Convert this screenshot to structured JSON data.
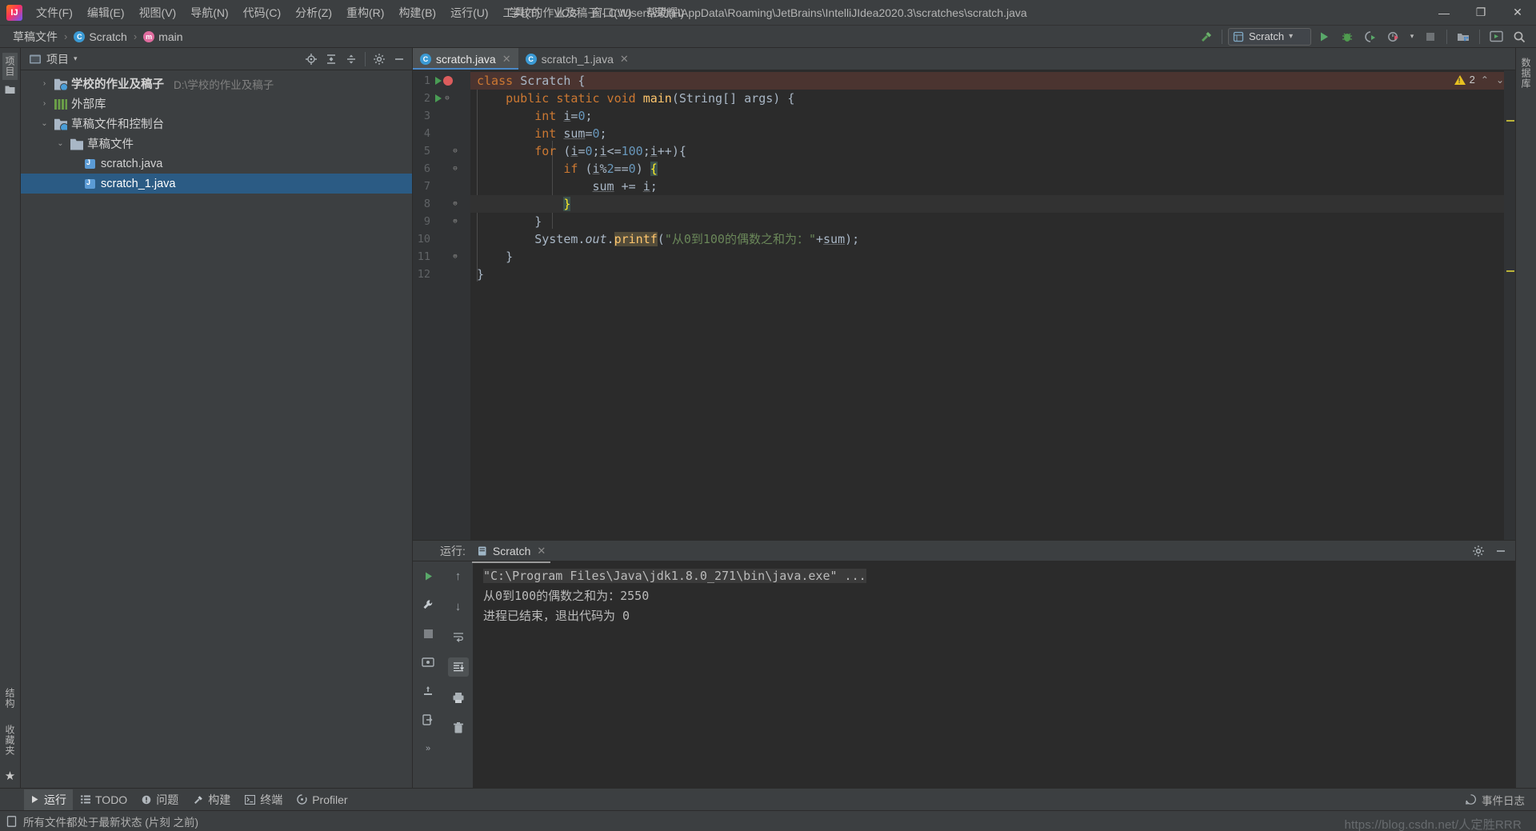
{
  "window": {
    "title": "学校的作业及稿子 - C:\\Users\\荣耀\\AppData\\Roaming\\JetBrains\\IntelliJIdea2020.3\\scratches\\scratch.java",
    "logo_text": "IJ",
    "minimize": "—",
    "maximize": "❐",
    "close": "✕"
  },
  "menu": {
    "items": [
      {
        "label": "文件(F)",
        "name": "menu-file"
      },
      {
        "label": "编辑(E)",
        "name": "menu-edit"
      },
      {
        "label": "视图(V)",
        "name": "menu-view"
      },
      {
        "label": "导航(N)",
        "name": "menu-navigate"
      },
      {
        "label": "代码(C)",
        "name": "menu-code"
      },
      {
        "label": "分析(Z)",
        "name": "menu-analyze"
      },
      {
        "label": "重构(R)",
        "name": "menu-refactor"
      },
      {
        "label": "构建(B)",
        "name": "menu-build"
      },
      {
        "label": "运行(U)",
        "name": "menu-run"
      },
      {
        "label": "工具(T)",
        "name": "menu-tools"
      },
      {
        "label": "VCS",
        "name": "menu-vcs"
      },
      {
        "label": "窗口(W)",
        "name": "menu-window"
      },
      {
        "label": "帮助(H)",
        "name": "menu-help"
      }
    ]
  },
  "navbar": {
    "breadcrumbs": [
      {
        "label": "草稿文件",
        "icon": "none"
      },
      {
        "label": "Scratch",
        "icon": "class-icon"
      },
      {
        "label": "main",
        "icon": "method-icon"
      }
    ],
    "separator": "›",
    "run_config": {
      "label": "Scratch",
      "icon": "scratch-config-icon",
      "chevron": "▾"
    },
    "buttons": [
      {
        "name": "build-hammer-icon",
        "title": "构建"
      },
      {
        "name": "run-button",
        "title": "运行"
      },
      {
        "name": "debug-button",
        "title": "调试"
      },
      {
        "name": "run-with-coverage-button",
        "title": "覆盖率运行"
      },
      {
        "name": "profiler-button",
        "title": "Profiler"
      },
      {
        "name": "stop-button",
        "title": "停止"
      },
      {
        "name": "project-structure-button",
        "title": "项目结构"
      },
      {
        "name": "updates-button",
        "title": "更新"
      },
      {
        "name": "search-everywhere-icon",
        "title": "搜索"
      }
    ]
  },
  "left_rail": {
    "top": [
      {
        "label": "项目",
        "name": "rail-project",
        "active": true
      },
      {
        "label": "",
        "name": "rail-bookmarks-icon",
        "active": false
      }
    ],
    "bottom": [
      {
        "label": "结构",
        "name": "rail-structure"
      },
      {
        "label": "收藏夹",
        "name": "rail-favorites"
      }
    ]
  },
  "right_rail": {
    "items": [
      {
        "label": "数据库",
        "name": "rail-database"
      }
    ]
  },
  "project_panel": {
    "title": "项目",
    "title_chevron": "▾",
    "header_buttons": [
      {
        "name": "locate-file-icon",
        "title": "定位"
      },
      {
        "name": "expand-all-icon",
        "title": "全部展开"
      },
      {
        "name": "collapse-all-icon",
        "title": "全部折叠"
      },
      {
        "name": "settings-gear-icon",
        "title": "设置"
      },
      {
        "name": "hide-panel-icon",
        "title": "隐藏"
      }
    ],
    "tree": [
      {
        "label": "学校的作业及稿子",
        "path": "D:\\学校的作业及稿子",
        "indent": 0,
        "arrow": "›",
        "icon": "module-folder-icon",
        "bold": true,
        "selected": false
      },
      {
        "label": "外部库",
        "path": "",
        "indent": 0,
        "arrow": "›",
        "icon": "library-icon",
        "bold": false,
        "selected": false
      },
      {
        "label": "草稿文件和控制台",
        "path": "",
        "indent": 0,
        "arrow": "⌄",
        "icon": "scratches-icon",
        "bold": false,
        "selected": false
      },
      {
        "label": "草稿文件",
        "path": "",
        "indent": 1,
        "arrow": "⌄",
        "icon": "folder-icon",
        "bold": false,
        "selected": false
      },
      {
        "label": "scratch.java",
        "path": "",
        "indent": 2,
        "arrow": "",
        "icon": "java-file-icon",
        "bold": false,
        "selected": false
      },
      {
        "label": "scratch_1.java",
        "path": "",
        "indent": 2,
        "arrow": "",
        "icon": "java-file-icon",
        "bold": false,
        "selected": true
      }
    ]
  },
  "editor": {
    "tabs": [
      {
        "label": "scratch.java",
        "active": true,
        "icon": "java-class-icon",
        "close": "✕"
      },
      {
        "label": "scratch_1.java",
        "active": false,
        "icon": "java-class-icon",
        "close": "✕"
      }
    ],
    "inspection": {
      "warning_count": "2",
      "up": "⌃",
      "down": "⌄"
    },
    "lines": [
      {
        "n": "1",
        "run": true,
        "breakpoint": true,
        "fold": "",
        "highlight": "breakpoint"
      },
      {
        "n": "2",
        "run": true,
        "breakpoint": false,
        "fold": "⊖",
        "highlight": ""
      },
      {
        "n": "3",
        "run": false,
        "breakpoint": false,
        "fold": "",
        "highlight": ""
      },
      {
        "n": "4",
        "run": false,
        "breakpoint": false,
        "fold": "",
        "highlight": ""
      },
      {
        "n": "5",
        "run": false,
        "breakpoint": false,
        "fold": "⊖",
        "highlight": ""
      },
      {
        "n": "6",
        "run": false,
        "breakpoint": false,
        "fold": "⊖",
        "highlight": ""
      },
      {
        "n": "7",
        "run": false,
        "breakpoint": false,
        "fold": "",
        "highlight": ""
      },
      {
        "n": "8",
        "run": false,
        "breakpoint": false,
        "fold": "⊜",
        "highlight": "caret"
      },
      {
        "n": "9",
        "run": false,
        "breakpoint": false,
        "fold": "⊜",
        "highlight": ""
      },
      {
        "n": "10",
        "run": false,
        "breakpoint": false,
        "fold": "",
        "highlight": ""
      },
      {
        "n": "11",
        "run": false,
        "breakpoint": false,
        "fold": "⊜",
        "highlight": ""
      },
      {
        "n": "12",
        "run": false,
        "breakpoint": false,
        "fold": "",
        "highlight": ""
      }
    ],
    "source_text": [
      "class Scratch {",
      "    public static void main(String[] args) {",
      "        int i=0;",
      "        int sum=0;",
      "        for (i=0;i<=100;i++){",
      "            if (i%2==0) {",
      "                sum += i;",
      "            }",
      "        }",
      "        System.out.printf(\"从0到100的偶数之和为：\"+sum);",
      "    }",
      "}"
    ]
  },
  "run_window": {
    "label": "运行:",
    "tab": {
      "label": "Scratch",
      "close": "✕",
      "icon": "run-config-icon"
    },
    "header_buttons": [
      {
        "name": "run-settings-gear-icon",
        "title": "设置"
      },
      {
        "name": "hide-run-window-icon",
        "title": "隐藏"
      }
    ],
    "side_buttons": [
      {
        "name": "rerun-button",
        "title": "重新运行"
      },
      {
        "name": "run-settings-wrench-icon",
        "title": "编辑配置"
      },
      {
        "name": "stop-process-button",
        "title": "停止"
      },
      {
        "name": "dump-threads-button",
        "title": "转储线程"
      },
      {
        "name": "restore-layout-button",
        "title": "恢复布局"
      },
      {
        "name": "exit-button",
        "title": "退出"
      },
      {
        "name": "expand-more-button",
        "title": "更多"
      }
    ],
    "side_buttons2": [
      {
        "name": "scroll-up-button",
        "title": "上一个"
      },
      {
        "name": "scroll-down-button",
        "title": "下一个"
      },
      {
        "name": "soft-wrap-button",
        "title": "软换行"
      },
      {
        "name": "scroll-to-end-button",
        "title": "滚动到末尾",
        "selected": true
      },
      {
        "name": "print-button",
        "title": "打印"
      },
      {
        "name": "clear-all-button",
        "title": "清除全部"
      }
    ],
    "console_lines": [
      {
        "text": "\"C:\\Program Files\\Java\\jdk1.8.0_271\\bin\\java.exe\" ...",
        "style": "command"
      },
      {
        "text": "从0到100的偶数之和为：2550",
        "style": "normal"
      },
      {
        "text": "进程已结束，退出代码为 0",
        "style": "normal"
      }
    ]
  },
  "tool_window_bar": {
    "items": [
      {
        "label": "运行",
        "name": "tw-run",
        "icon": "play-icon",
        "active": true
      },
      {
        "label": "TODO",
        "name": "tw-todo",
        "icon": "list-icon",
        "active": false
      },
      {
        "label": "问题",
        "name": "tw-problems",
        "icon": "error-icon",
        "active": false
      },
      {
        "label": "构建",
        "name": "tw-build",
        "icon": "hammer-icon",
        "active": false
      },
      {
        "label": "终端",
        "name": "tw-terminal",
        "icon": "terminal-icon",
        "active": false
      },
      {
        "label": "Profiler",
        "name": "tw-profiler",
        "icon": "profiler-icon",
        "active": false
      }
    ],
    "event_log": {
      "label": "事件日志",
      "icon": "event-log-icon"
    }
  },
  "status_bar": {
    "text": "所有文件都处于最新状态 (片刻 之前)",
    "icon": "document-icon",
    "watermark": "https://blog.csdn.net/人定胜RRR"
  }
}
